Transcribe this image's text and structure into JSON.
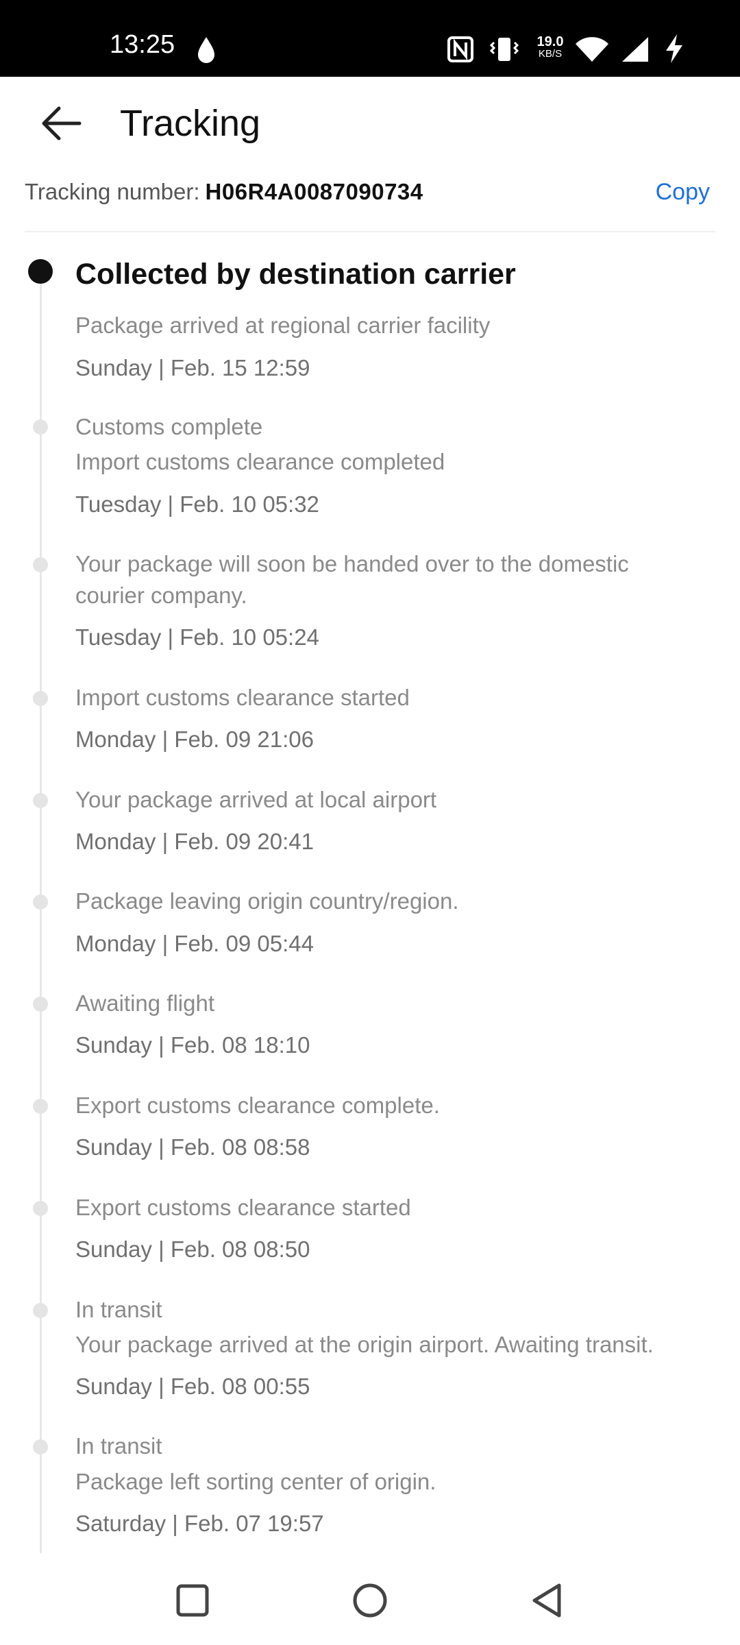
{
  "status_bar": {
    "time": "13:25",
    "speed_value": "19.0",
    "speed_unit": "KB/S",
    "icons": [
      "water-drop-icon",
      "nfc-icon",
      "vibrate-icon",
      "wifi-icon",
      "signal-icon",
      "charging-icon"
    ]
  },
  "header": {
    "title": "Tracking",
    "back_icon": "arrow-left-icon"
  },
  "tracking": {
    "label": "Tracking number:",
    "number": "H06R4A0087090734",
    "copy_label": "Copy"
  },
  "events": [
    {
      "title": "Collected by destination carrier",
      "desc": "Package arrived at regional carrier facility",
      "time": "Sunday | Feb. 15 12:59"
    },
    {
      "title": "Customs complete",
      "desc": "Import customs clearance completed",
      "time": "Tuesday | Feb. 10 05:32"
    },
    {
      "title": "Your package will soon be handed over to the domestic",
      "desc": "courier company.",
      "time": "Tuesday | Feb. 10 05:24"
    },
    {
      "title": "Import customs clearance started",
      "time": "Monday | Feb. 09 21:06"
    },
    {
      "title": "Your package arrived at local airport",
      "time": "Monday | Feb. 09 20:41"
    },
    {
      "title": "Package leaving origin country/region.",
      "time": "Monday | Feb. 09 05:44"
    },
    {
      "title": "Awaiting flight",
      "time": "Sunday | Feb. 08 18:10"
    },
    {
      "title": "Export customs clearance complete.",
      "time": "Sunday | Feb. 08 08:58"
    },
    {
      "title": "Export customs clearance started",
      "time": "Sunday | Feb. 08 08:50"
    },
    {
      "title": "In transit",
      "desc": "Your package arrived at the origin airport. Awaiting transit.",
      "time": "Sunday | Feb. 08 00:55"
    },
    {
      "title": "In transit",
      "desc": "Package left sorting center of origin.",
      "time": "Saturday | Feb. 07 19:57"
    }
  ],
  "nav": {
    "icons": [
      "recents-square-icon",
      "home-circle-icon",
      "back-triangle-icon"
    ]
  },
  "colors": {
    "accent": "#1f6fd6",
    "active_dot": "#111111",
    "inactive_dot": "#e4e4e4"
  }
}
